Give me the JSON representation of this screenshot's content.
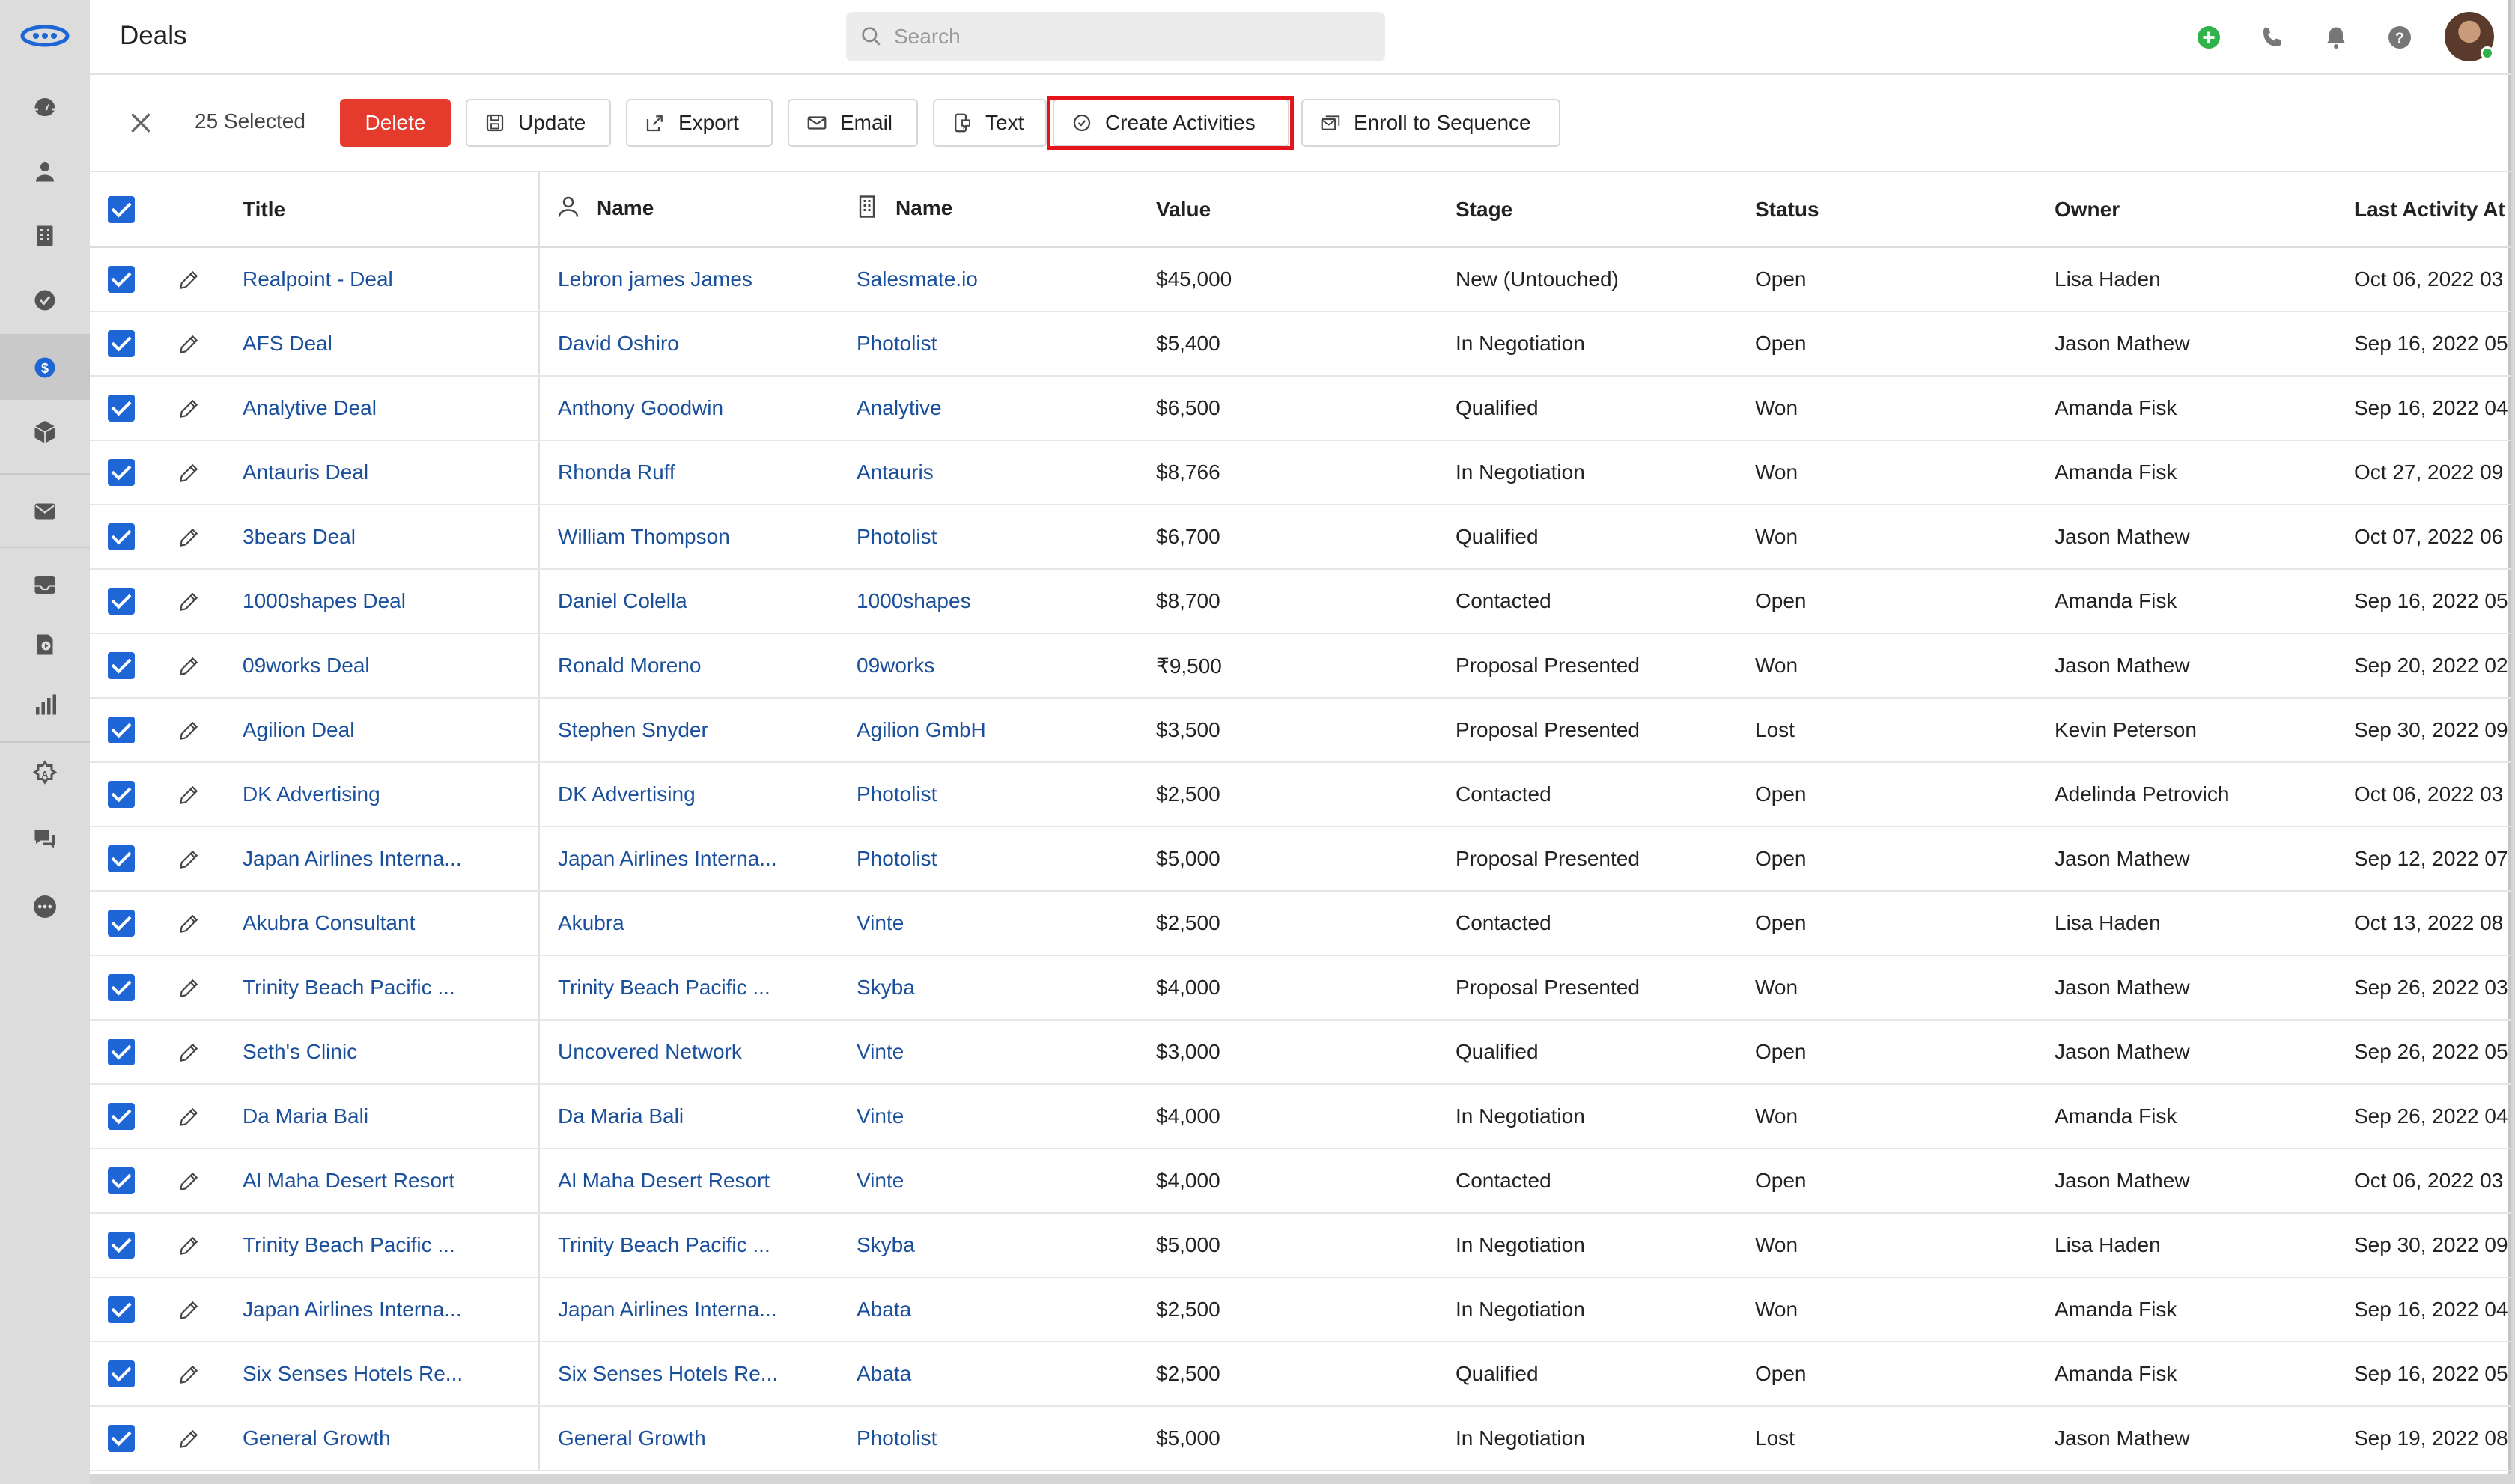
{
  "app": {
    "page_title": "Deals"
  },
  "search": {
    "placeholder": "Search"
  },
  "actions": {
    "selected_label": "25 Selected",
    "delete": "Delete",
    "update": "Update",
    "export": "Export",
    "email": "Email",
    "text": "Text",
    "create_activities": "Create Activities",
    "enroll": "Enroll to Sequence"
  },
  "colors": {
    "accent": "#1e66d6",
    "danger": "#e53b2c",
    "highlight": "#e5141a",
    "link": "#1a4f9c"
  },
  "table": {
    "headers": {
      "title": "Title",
      "contact_name": "Name",
      "company_name": "Name",
      "value": "Value",
      "stage": "Stage",
      "status": "Status",
      "owner": "Owner",
      "last_activity": "Last Activity At"
    },
    "rows": [
      {
        "title": "Realpoint - Deal",
        "contact": "Lebron james James",
        "company": "Salesmate.io",
        "value": "$45,000",
        "stage": "New (Untouched)",
        "status": "Open",
        "owner": "Lisa Haden",
        "last": "Oct 06, 2022 03"
      },
      {
        "title": "AFS Deal",
        "contact": "David Oshiro",
        "company": "Photolist",
        "value": "$5,400",
        "stage": "In Negotiation",
        "status": "Open",
        "owner": "Jason Mathew",
        "last": "Sep 16, 2022 05"
      },
      {
        "title": "Analytive Deal",
        "contact": "Anthony Goodwin",
        "company": "Analytive",
        "value": "$6,500",
        "stage": "Qualified",
        "status": "Won",
        "owner": "Amanda Fisk",
        "last": "Sep 16, 2022 04"
      },
      {
        "title": "Antauris Deal",
        "contact": "Rhonda Ruff",
        "company": "Antauris",
        "value": "$8,766",
        "stage": "In Negotiation",
        "status": "Won",
        "owner": "Amanda Fisk",
        "last": "Oct 27, 2022 09"
      },
      {
        "title": "3bears Deal",
        "contact": "William Thompson",
        "company": "Photolist",
        "value": "$6,700",
        "stage": "Qualified",
        "status": "Won",
        "owner": "Jason Mathew",
        "last": "Oct 07, 2022 06"
      },
      {
        "title": "1000shapes Deal",
        "contact": "Daniel Colella",
        "company": "1000shapes",
        "value": "$8,700",
        "stage": "Contacted",
        "status": "Open",
        "owner": "Amanda Fisk",
        "last": "Sep 16, 2022 05"
      },
      {
        "title": "09works Deal",
        "contact": "Ronald Moreno",
        "company": "09works",
        "value": "₹9,500",
        "stage": "Proposal Presented",
        "status": "Won",
        "owner": "Jason Mathew",
        "last": "Sep 20, 2022 02"
      },
      {
        "title": "Agilion Deal",
        "contact": "Stephen Snyder",
        "company": "Agilion GmbH",
        "value": "$3,500",
        "stage": "Proposal Presented",
        "status": "Lost",
        "owner": "Kevin Peterson",
        "last": "Sep 30, 2022 09"
      },
      {
        "title": "DK Advertising",
        "contact": "DK Advertising",
        "company": "Photolist",
        "value": "$2,500",
        "stage": "Contacted",
        "status": "Open",
        "owner": "Adelinda Petrovich",
        "last": "Oct 06, 2022 03"
      },
      {
        "title": "Japan Airlines Interna...",
        "contact": "Japan Airlines Interna...",
        "company": "Photolist",
        "value": "$5,000",
        "stage": "Proposal Presented",
        "status": "Open",
        "owner": "Jason Mathew",
        "last": "Sep 12, 2022 07"
      },
      {
        "title": "Akubra Consultant",
        "contact": "Akubra",
        "company": "Vinte",
        "value": "$2,500",
        "stage": "Contacted",
        "status": "Open",
        "owner": "Lisa Haden",
        "last": "Oct 13, 2022 08"
      },
      {
        "title": "Trinity Beach Pacific ...",
        "contact": "Trinity Beach Pacific ...",
        "company": "Skyba",
        "value": "$4,000",
        "stage": "Proposal Presented",
        "status": "Won",
        "owner": "Jason Mathew",
        "last": "Sep 26, 2022 03"
      },
      {
        "title": "Seth's Clinic",
        "contact": "Uncovered Network",
        "company": "Vinte",
        "value": "$3,000",
        "stage": "Qualified",
        "status": "Open",
        "owner": "Jason Mathew",
        "last": "Sep 26, 2022 05"
      },
      {
        "title": "Da Maria Bali",
        "contact": "Da Maria Bali",
        "company": "Vinte",
        "value": "$4,000",
        "stage": "In Negotiation",
        "status": "Won",
        "owner": "Amanda Fisk",
        "last": "Sep 26, 2022 04"
      },
      {
        "title": "Al Maha Desert Resort",
        "contact": "Al Maha Desert Resort",
        "company": "Vinte",
        "value": "$4,000",
        "stage": "Contacted",
        "status": "Open",
        "owner": "Jason Mathew",
        "last": "Oct 06, 2022 03"
      },
      {
        "title": "Trinity Beach Pacific ...",
        "contact": "Trinity Beach Pacific ...",
        "company": "Skyba",
        "value": "$5,000",
        "stage": "In Negotiation",
        "status": "Won",
        "owner": "Lisa Haden",
        "last": "Sep 30, 2022 09"
      },
      {
        "title": "Japan Airlines Interna...",
        "contact": "Japan Airlines Interna...",
        "company": "Abata",
        "value": "$2,500",
        "stage": "In Negotiation",
        "status": "Won",
        "owner": "Amanda Fisk",
        "last": "Sep 16, 2022 04"
      },
      {
        "title": "Six Senses Hotels Re...",
        "contact": "Six Senses Hotels Re...",
        "company": "Abata",
        "value": "$2,500",
        "stage": "Qualified",
        "status": "Open",
        "owner": "Amanda Fisk",
        "last": "Sep 16, 2022 05"
      },
      {
        "title": "General Growth",
        "contact": "General Growth",
        "company": "Photolist",
        "value": "$5,000",
        "stage": "In Negotiation",
        "status": "Lost",
        "owner": "Jason Mathew",
        "last": "Sep 19, 2022 08"
      }
    ]
  }
}
